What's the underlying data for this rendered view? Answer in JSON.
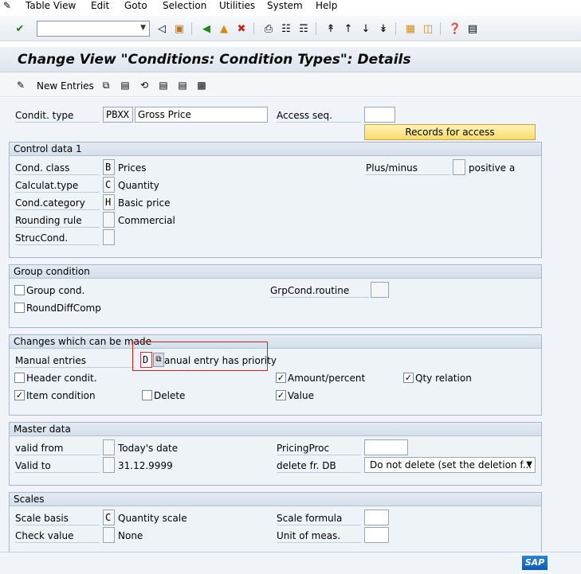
{
  "menubar": {
    "items": [
      "Table View",
      "Edit",
      "Goto",
      "Selection",
      "Utilities",
      "System",
      "Help"
    ]
  },
  "title": "Change View \"Conditions: Condition Types\": Details",
  "app_toolbar": {
    "new_entries": "New Entries"
  },
  "header": {
    "condit_type_label": "Condit. type",
    "condit_type_value": "PBXX",
    "condit_type_desc": "Gross Price",
    "access_seq_label": "Access seq.",
    "access_seq_value": "",
    "records_button": "Records for access"
  },
  "control_data": {
    "title": "Control data 1",
    "cond_class_label": "Cond. class",
    "cond_class_value": "B",
    "cond_class_desc": "Prices",
    "plus_minus_label": "Plus/minus",
    "plus_minus_desc": "positive a",
    "calc_type_label": "Calculat.type",
    "calc_type_value": "C",
    "calc_type_desc": "Quantity",
    "cond_category_label": "Cond.category",
    "cond_category_value": "H",
    "cond_category_desc": "Basic price",
    "rounding_label": "Rounding rule",
    "rounding_desc": "Commercial",
    "struc_label": "StrucCond."
  },
  "group_condition": {
    "title": "Group condition",
    "group_cond_label": "Group cond.",
    "group_cond_checked": false,
    "grpcond_routine_label": "GrpCond.routine",
    "round_diff_label": "RoundDiffComp",
    "round_diff_checked": false
  },
  "changes": {
    "title": "Changes which can be made",
    "manual_entries_label": "Manual entries",
    "manual_entries_value": "D",
    "manual_entries_desc": "anual entry has priority",
    "header_condit_label": "Header condit.",
    "header_condit_checked": false,
    "amount_percent_label": "Amount/percent",
    "amount_percent_checked": true,
    "qty_relation_label": "Qty relation",
    "qty_relation_checked": true,
    "item_condition_label": "Item condition",
    "item_condition_checked": true,
    "delete_label": "Delete",
    "delete_checked": false,
    "value_label": "Value",
    "value_checked": true
  },
  "master_data": {
    "title": "Master data",
    "valid_from_label": "valid from",
    "valid_from_desc": "Today's date",
    "pricing_proc_label": "PricingProc",
    "valid_to_label": "Valid to",
    "valid_to_desc": "31.12.9999",
    "delete_db_label": "delete fr. DB",
    "delete_db_value": "Do not delete (set the deletion f..."
  },
  "scales": {
    "title": "Scales",
    "scale_basis_label": "Scale basis",
    "scale_basis_value": "C",
    "scale_basis_desc": "Quantity scale",
    "scale_formula_label": "Scale formula",
    "check_value_label": "Check value",
    "check_value_desc": "None",
    "unit_meas_label": "Unit of meas."
  },
  "colors": {
    "highlight": "#d02020",
    "records_button": "#f7dc6d",
    "group_header": "#d4dfea"
  }
}
